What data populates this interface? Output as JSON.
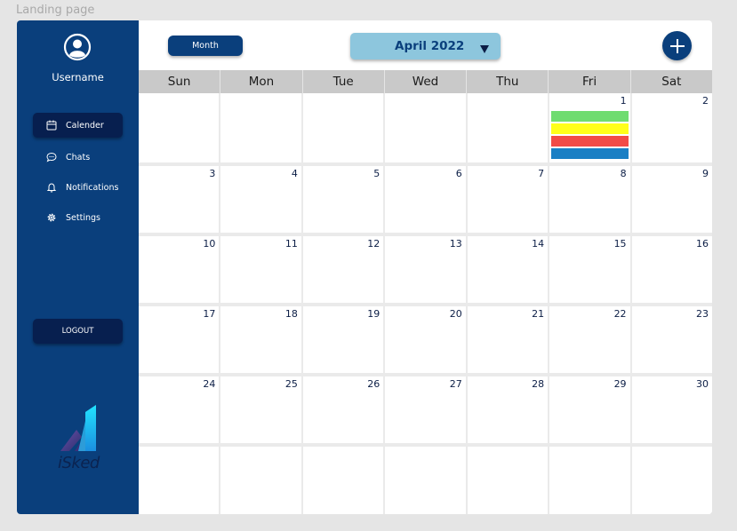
{
  "frame_label": "Landing page",
  "sidebar": {
    "username": "Username",
    "items": [
      {
        "label": "Calender",
        "icon": "calendar-icon",
        "active": true
      },
      {
        "label": "Chats",
        "icon": "chat-icon",
        "active": false
      },
      {
        "label": "Notifications",
        "icon": "bell-icon",
        "active": false
      },
      {
        "label": "Settings",
        "icon": "gear-icon",
        "active": false
      }
    ],
    "logout_label": "LOGOUT",
    "logo_text": "iSked"
  },
  "toolbar": {
    "month_button_label": "Month",
    "month_select_label": "April 2022",
    "add_button_icon": "plus-icon"
  },
  "calendar": {
    "day_names": [
      "Sun",
      "Mon",
      "Tue",
      "Wed",
      "Thu",
      "Fri",
      "Sat"
    ],
    "weeks": [
      [
        "",
        "",
        "",
        "",
        "",
        "1",
        "2"
      ],
      [
        "3",
        "4",
        "5",
        "6",
        "7",
        "8",
        "9"
      ],
      [
        "10",
        "11",
        "12",
        "13",
        "14",
        "15",
        "16"
      ],
      [
        "17",
        "18",
        "19",
        "20",
        "21",
        "22",
        "23"
      ],
      [
        "24",
        "25",
        "26",
        "27",
        "28",
        "29",
        "30"
      ],
      [
        "",
        "",
        "",
        "",
        "",
        "",
        ""
      ]
    ],
    "events_day": "1",
    "event_colors": [
      "#6fdc70",
      "#ffff1a",
      "#f24b47",
      "#1a7fc4"
    ]
  },
  "colors": {
    "sidebar": "#0a3f7c",
    "active": "#071f4f",
    "accent": "#8dc6dd",
    "header": "#c9c9c9"
  }
}
